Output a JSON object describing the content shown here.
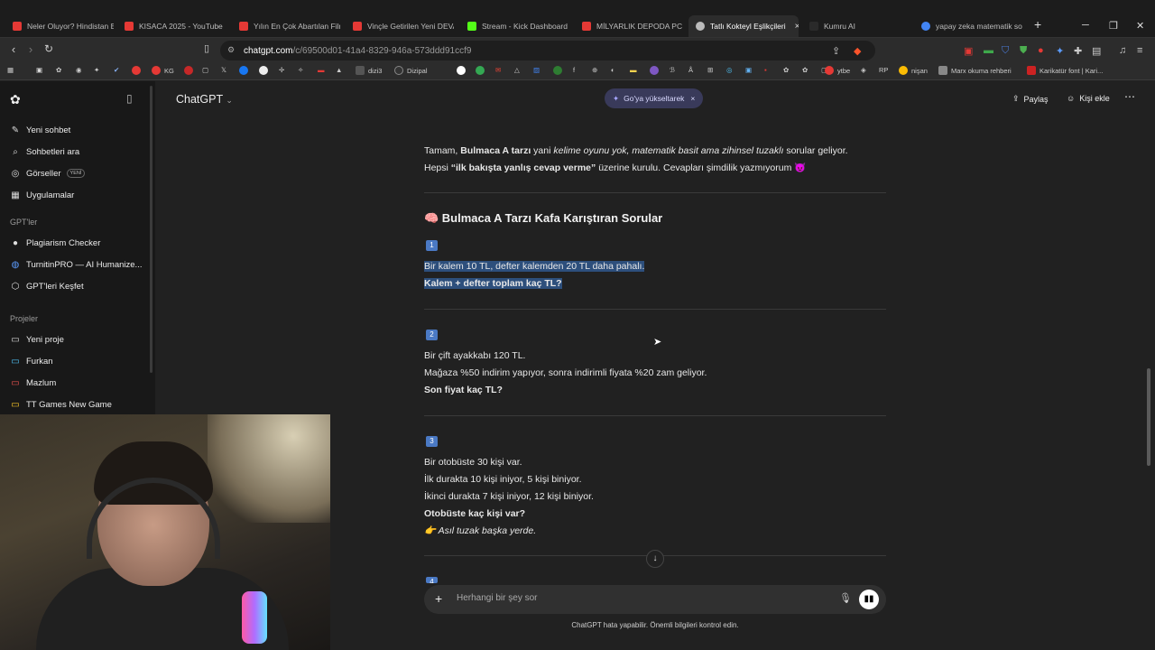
{
  "browser": {
    "tabs": [
      {
        "title": "Neler Oluyor? Hindistan B",
        "color": "#e53935"
      },
      {
        "title": "KISACA 2025 - YouTube",
        "color": "#e53935"
      },
      {
        "title": "Yılın En Çok Abartılan Filmi",
        "color": "#e53935"
      },
      {
        "title": "Vinçle Getirilen Yeni DEVA",
        "color": "#e53935"
      },
      {
        "title": "Stream - Kick Dashboard",
        "color": "#53fc18"
      },
      {
        "title": "MİLYARLIK DEPODA PC TO",
        "color": "#e53935"
      },
      {
        "title": "Tatlı Kokteyl Eşlikçileri",
        "color": "#bbbbbb"
      },
      {
        "title": "Kumru AI",
        "color": "#2a2a2a"
      },
      {
        "title": "yapay zeka matematik sor",
        "color": "#4285f4"
      }
    ],
    "active_tab_close": "×",
    "new_tab": "+",
    "url_domain": "chatgpt.com",
    "url_path": "/c/69500d01-41a4-8329-946a-573ddd91ccf9",
    "bookmarks": [
      {
        "label": "KG",
        "color": "#e53935"
      },
      {
        "label": "dizi3",
        "color": "#555555"
      },
      {
        "label": "Dizipal",
        "color": "#333333"
      },
      {
        "label": "ytbe",
        "color": "#e53935"
      },
      {
        "label": "RP",
        "color": "#777777"
      },
      {
        "label": "nişan",
        "color": "#999999"
      },
      {
        "label": "Marx okuma rehberi",
        "color": "#888888"
      },
      {
        "label": "Karikatür font | Kari...",
        "color": "#cc2222"
      }
    ]
  },
  "sidebar": {
    "items": [
      {
        "label": "Yeni sohbet",
        "icon": "edit-icon",
        "glyph": "✎"
      },
      {
        "label": "Sohbetleri ara",
        "icon": "search-icon",
        "glyph": "⌕"
      },
      {
        "label": "Görseller",
        "icon": "image-icon",
        "glyph": "◎",
        "badge": "YENİ"
      },
      {
        "label": "Uygulamalar",
        "icon": "apps-icon",
        "glyph": "▦"
      }
    ],
    "gpts_heading": "GPT'ler",
    "gpts": [
      {
        "label": "Plagiarism Checker",
        "icon": "plagiarism-checker-icon",
        "glyph": "●"
      },
      {
        "label": "TurnitinPRO — AI Humanize...",
        "icon": "turnitin-icon",
        "glyph": "◍"
      },
      {
        "label": "GPT'leri Keşfet",
        "icon": "explore-icon",
        "glyph": "⬡"
      }
    ],
    "projects_heading": "Projeler",
    "projects": [
      {
        "label": "Yeni proje",
        "icon": "folder-add-icon",
        "glyph": "▭",
        "color": "#ececec"
      },
      {
        "label": "Furkan",
        "icon": "folder-icon",
        "glyph": "▭",
        "color": "#4fc3f7"
      },
      {
        "label": "Mazlum",
        "icon": "folder-icon",
        "glyph": "▭",
        "color": "#ef5350"
      },
      {
        "label": "TT Games New Game",
        "icon": "folder-icon",
        "glyph": "▭",
        "color": "#ffca28"
      }
    ]
  },
  "header": {
    "model": "ChatGPT",
    "upgrade": "Go'ya yükseltarek",
    "upgrade_close": "×",
    "share": "Paylaş",
    "add_person": "Kişi ekle",
    "more": "⋯"
  },
  "chat": {
    "intro_1_pre": "Tamam, ",
    "intro_1_bold": "Bulmaca A tarzı",
    "intro_1_mid": " yani ",
    "intro_1_italic": "kelime oyunu yok, matematik basit ama zihinsel tuzaklı",
    "intro_1_post": " sorular geliyor.",
    "intro_2_pre": "Hepsi ",
    "intro_2_bold": "“ilk bakışta yanlış cevap verme”",
    "intro_2_post": " üzerine kurulu. Cevapları şimdilik yazmıyorum 😈",
    "heading": "🧠 Bulmaca A Tarzı Kafa Karıştıran Sorular",
    "questions": [
      {
        "number": "1",
        "lines": [
          "Bir kalem 10 TL, defter kalemden 20 TL daha pahalı."
        ],
        "bold": "Kalem + defter toplam kaç TL?"
      },
      {
        "number": "2",
        "lines": [
          "Bir çift ayakkabı 120 TL.",
          "Mağaza %50 indirim yapıyor, sonra indirimli fiyata %20 zam geliyor."
        ],
        "bold": "Son fiyat kaç TL?"
      },
      {
        "number": "3",
        "lines": [
          "Bir otobüste 30 kişi var.",
          "İlk durakta 10 kişi iniyor, 5 kişi biniyor.",
          "İkinci durakta 7 kişi iniyor, 12 kişi biniyor."
        ],
        "bold": "Otobüste kaç kişi var?",
        "hint": "👉 Asıl tuzak başka yerde."
      }
    ],
    "next_number": "4"
  },
  "composer": {
    "placeholder": "Herhangi bir şey sor",
    "footnote": "ChatGPT hata yapabilir. Önemli bilgileri kontrol edin."
  }
}
